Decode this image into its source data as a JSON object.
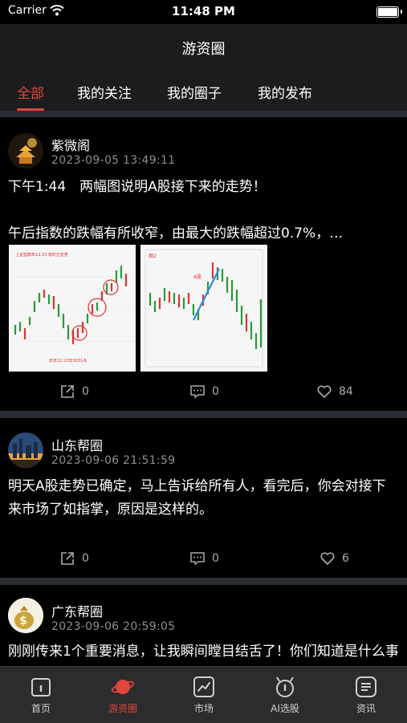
{
  "status_bar": {
    "carrier": "Carrier",
    "time": "11:48 PM"
  },
  "header": {
    "title": "游资圈"
  },
  "tabs": [
    "全部",
    "我的关注",
    "我的圈子",
    "我的发布"
  ],
  "posts": [
    {
      "author": "紫微阁",
      "time": "2023-09-05 13:49:11",
      "text": "下午1:44　两幅图说明A股接下来的走势！\n\n午后指数的跌幅有所收窄，由最大的跌幅超过0.7%，…",
      "images": [
        {
          "label": "上证指数年12.23\n有时正走势",
          "footer": "去年12.23年3031点"
        },
        {
          "label": "图2",
          "marker": "A股"
        }
      ],
      "share": "0",
      "comments": "0",
      "likes": "84"
    },
    {
      "author": "山东帮圈",
      "time": "2023-09-06 21:51:59",
      "text": "明天A股走势已确定，马上告诉给所有人，看完后，你会对接下来市场了如指掌，原因是这样的。",
      "share": "0",
      "comments": "0",
      "likes": "6"
    },
    {
      "author": "广东帮圈",
      "time": "2023-09-06 20:59:05",
      "text": "刚刚传来1个重要消息，让我瞬间瞠目结舌了！你们知道是什么事"
    }
  ],
  "tabbar": [
    {
      "label": "首页",
      "icon": "home-icon"
    },
    {
      "label": "游资圈",
      "icon": "planet-icon",
      "active": true
    },
    {
      "label": "市场",
      "icon": "chart-icon"
    },
    {
      "label": "AI选股",
      "icon": "robot-icon"
    },
    {
      "label": "资讯",
      "icon": "news-icon"
    }
  ],
  "colors": {
    "accent": "#e0463c",
    "header_bg": "#1c1c1e",
    "separator": "#2a2d34"
  }
}
